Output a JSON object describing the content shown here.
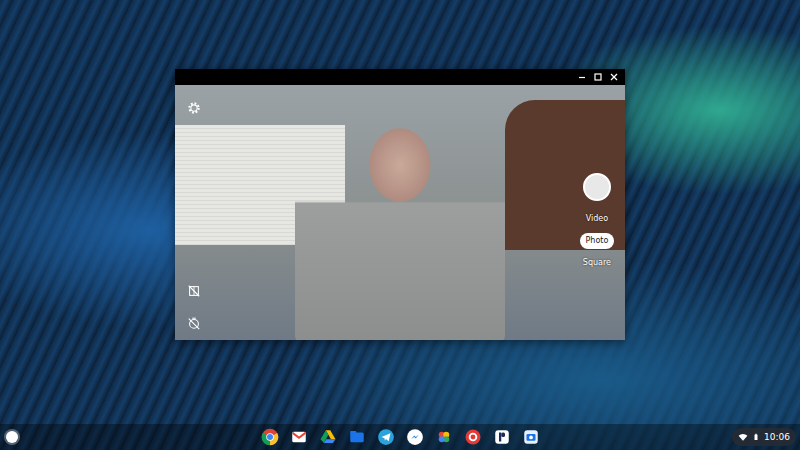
{
  "camera": {
    "modes": [
      {
        "label": "Video",
        "selected": false
      },
      {
        "label": "Photo",
        "selected": true
      },
      {
        "label": "Square",
        "selected": false
      }
    ]
  },
  "shelf": {
    "apps": [
      {
        "kind": "chrome"
      },
      {
        "kind": "gmail"
      },
      {
        "kind": "drive"
      },
      {
        "kind": "files"
      },
      {
        "kind": "telegram"
      },
      {
        "kind": "messenger"
      },
      {
        "kind": "photos"
      },
      {
        "kind": "acrobat"
      },
      {
        "kind": "reader"
      },
      {
        "kind": "camera"
      }
    ]
  },
  "status": {
    "time": "10:06"
  }
}
